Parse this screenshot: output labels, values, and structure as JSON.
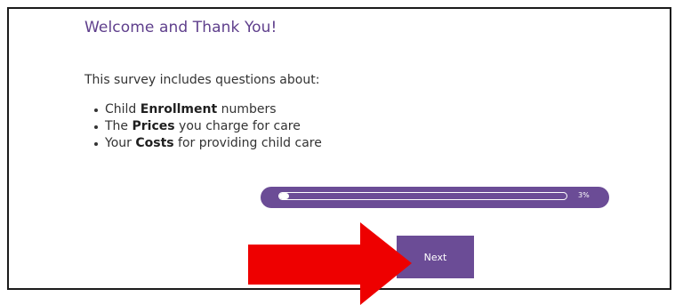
{
  "survey": {
    "title": "Welcome and Thank You!",
    "intro": "This survey includes questions about:",
    "bullets": [
      {
        "prefix": "Child ",
        "bold": "Enrollment",
        "suffix": " numbers"
      },
      {
        "prefix": "The ",
        "bold": "Prices",
        "suffix": " you charge for care"
      },
      {
        "prefix": "Your ",
        "bold": "Costs",
        "suffix": " for providing child care"
      }
    ]
  },
  "progress": {
    "label": "3%",
    "value": 0.03
  },
  "next_button": {
    "label": "Next"
  },
  "annotation": {
    "arrow_color": "#ee0000",
    "arrow_icon": "right-arrow-icon"
  },
  "colors": {
    "brand_purple": "#6b4c96",
    "title_purple": "#5f3f8c",
    "frame_border": "#1b1b1b"
  }
}
